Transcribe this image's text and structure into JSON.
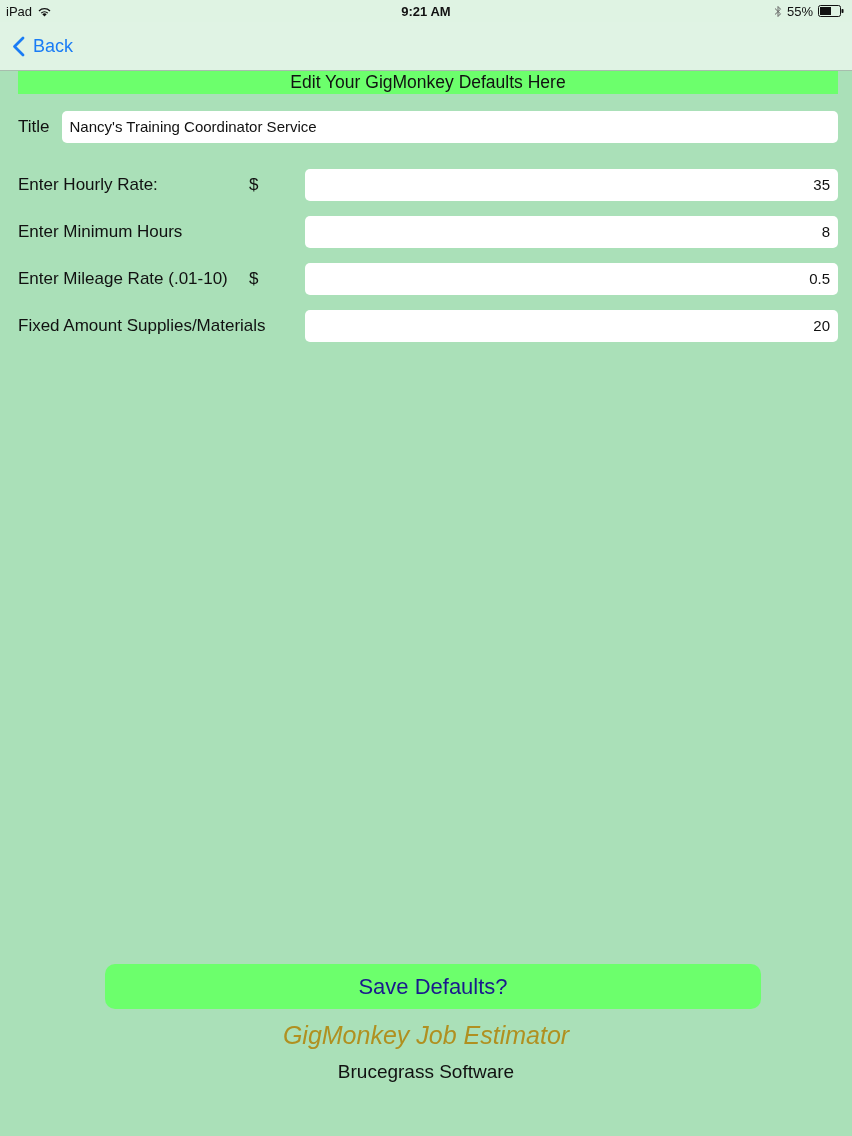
{
  "status_bar": {
    "device": "iPad",
    "time": "9:21 AM",
    "battery": "55%"
  },
  "nav_bar": {
    "back": "Back"
  },
  "banner": "Edit Your GigMonkey Defaults Here",
  "title_field": {
    "label": "Title",
    "value": "Nancy's Training Coordinator Service"
  },
  "fields": [
    {
      "label": "Enter Hourly Rate:",
      "prefix": "$",
      "value": "35"
    },
    {
      "label": "Enter Minimum Hours",
      "value": "8"
    },
    {
      "label": "Enter Mileage Rate (.01-10)",
      "prefix": "$",
      "value": "0.5"
    },
    {
      "label": "Fixed Amount Supplies/Materials",
      "value": "20"
    }
  ],
  "save_button": "Save Defaults?",
  "app_name": "GigMonkey Job Estimator",
  "company": "Brucegrass Software"
}
